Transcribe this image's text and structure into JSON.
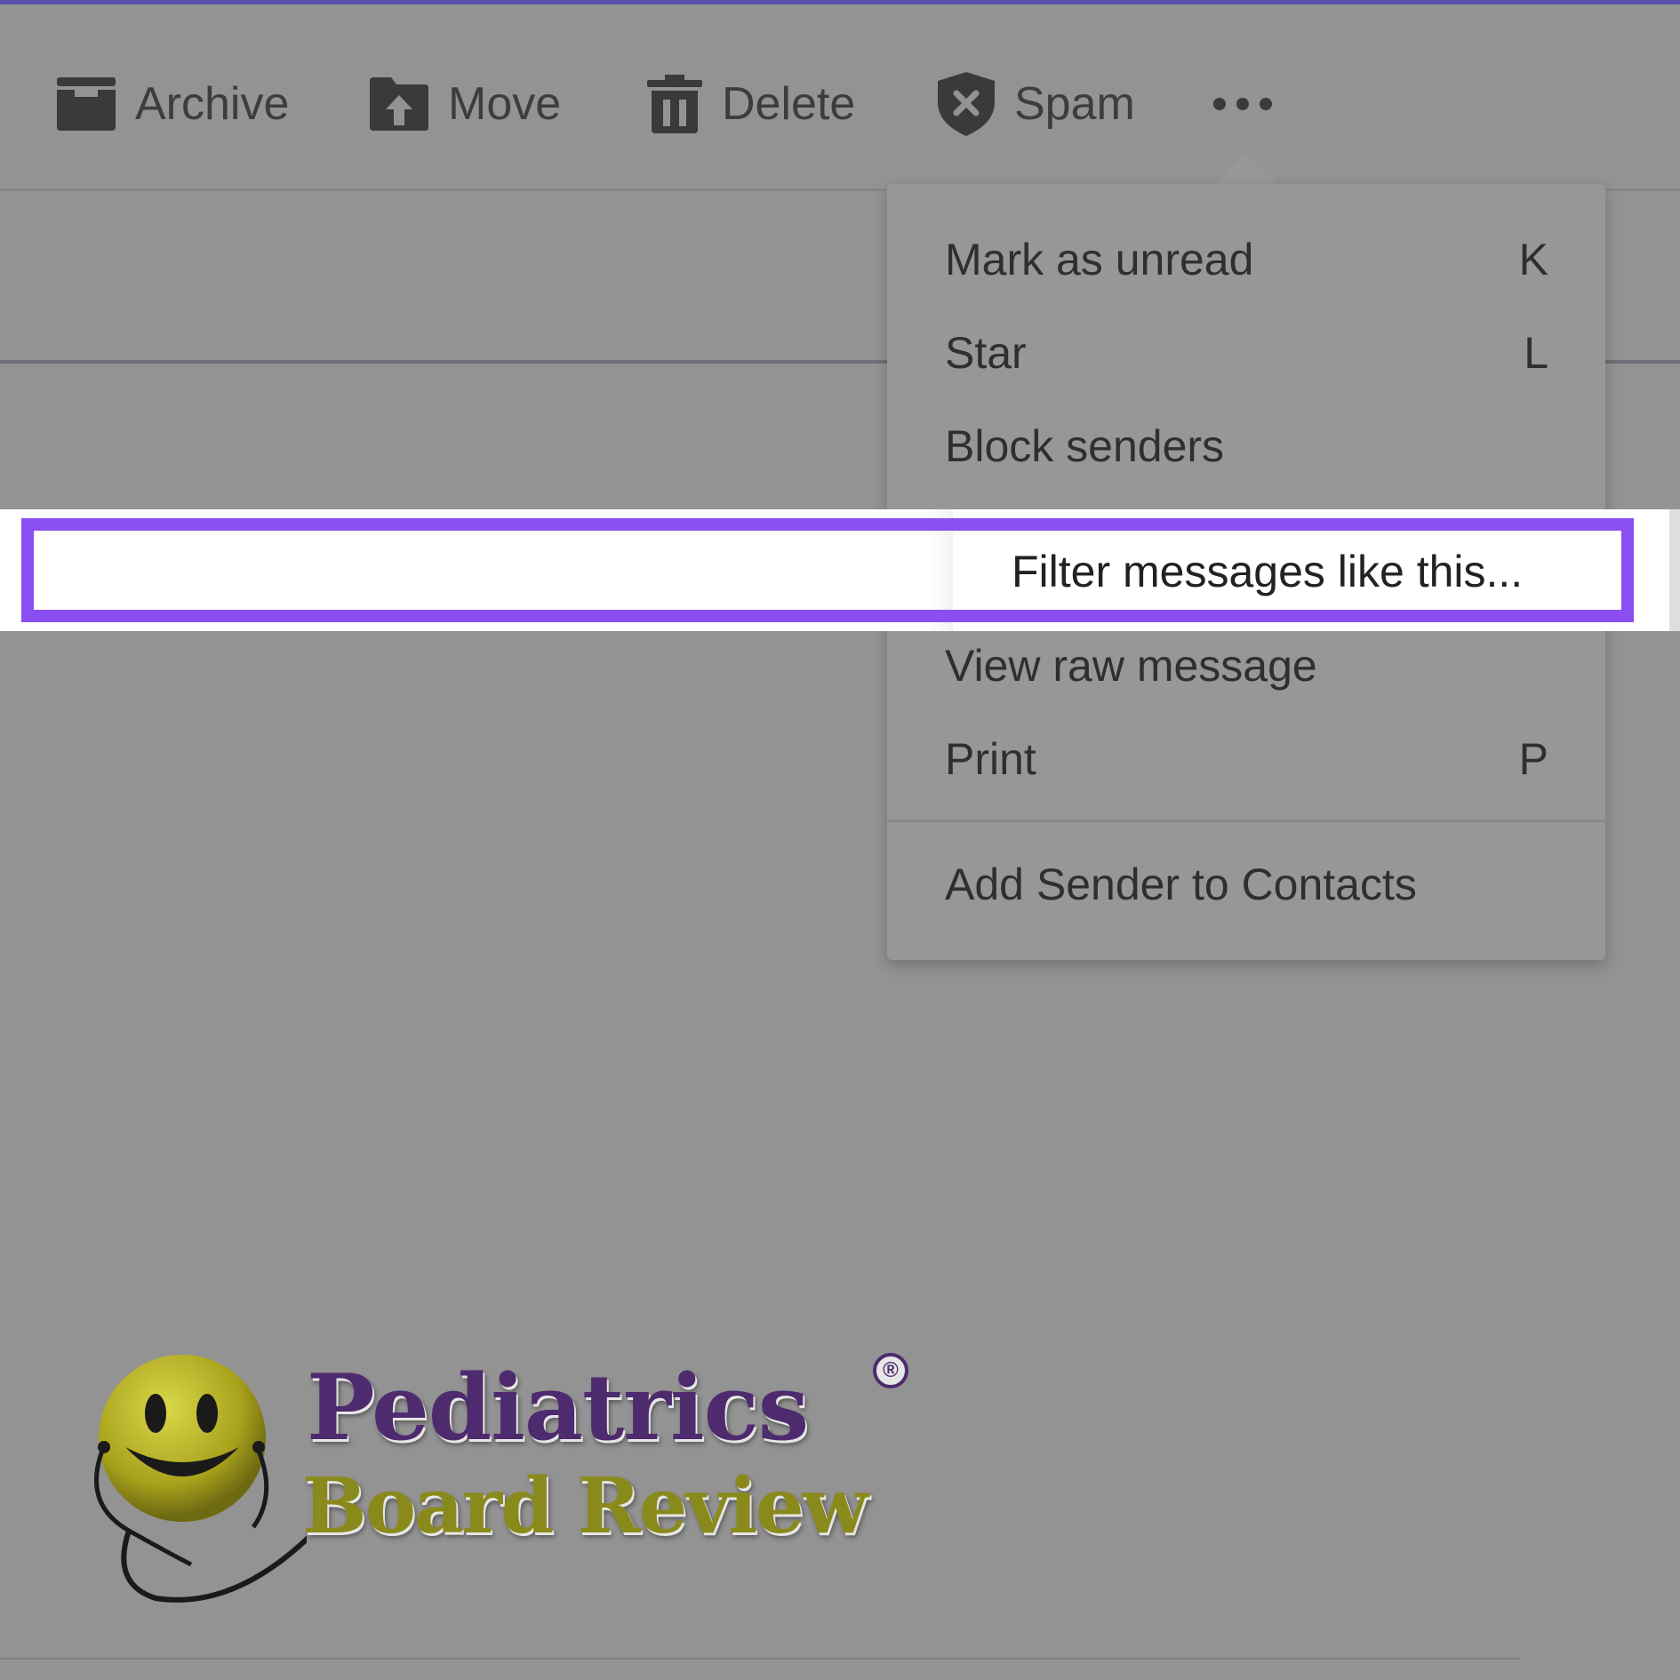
{
  "toolbar": {
    "archive_label": "Archive",
    "move_label": "Move",
    "delete_label": "Delete",
    "spam_label": "Spam",
    "more_icon": "more-horizontal-icon"
  },
  "menu": {
    "items": [
      {
        "label": "Mark as unread",
        "shortcut": "K"
      },
      {
        "label": "Star",
        "shortcut": "L"
      },
      {
        "label": "Block senders",
        "shortcut": ""
      },
      {
        "label": "Filter messages like this...",
        "shortcut": "",
        "highlighted": true
      },
      {
        "label": "View raw message",
        "shortcut": ""
      },
      {
        "label": "Print",
        "shortcut": "P"
      },
      {
        "label": "Add Sender to Contacts",
        "shortcut": ""
      }
    ]
  },
  "logo": {
    "line1": "Pediatrics",
    "line2": "Board Review",
    "registered": "®"
  },
  "colors": {
    "highlight": "#8a4ff2",
    "top_accent": "#5a52a8",
    "overlay": "#939393"
  }
}
